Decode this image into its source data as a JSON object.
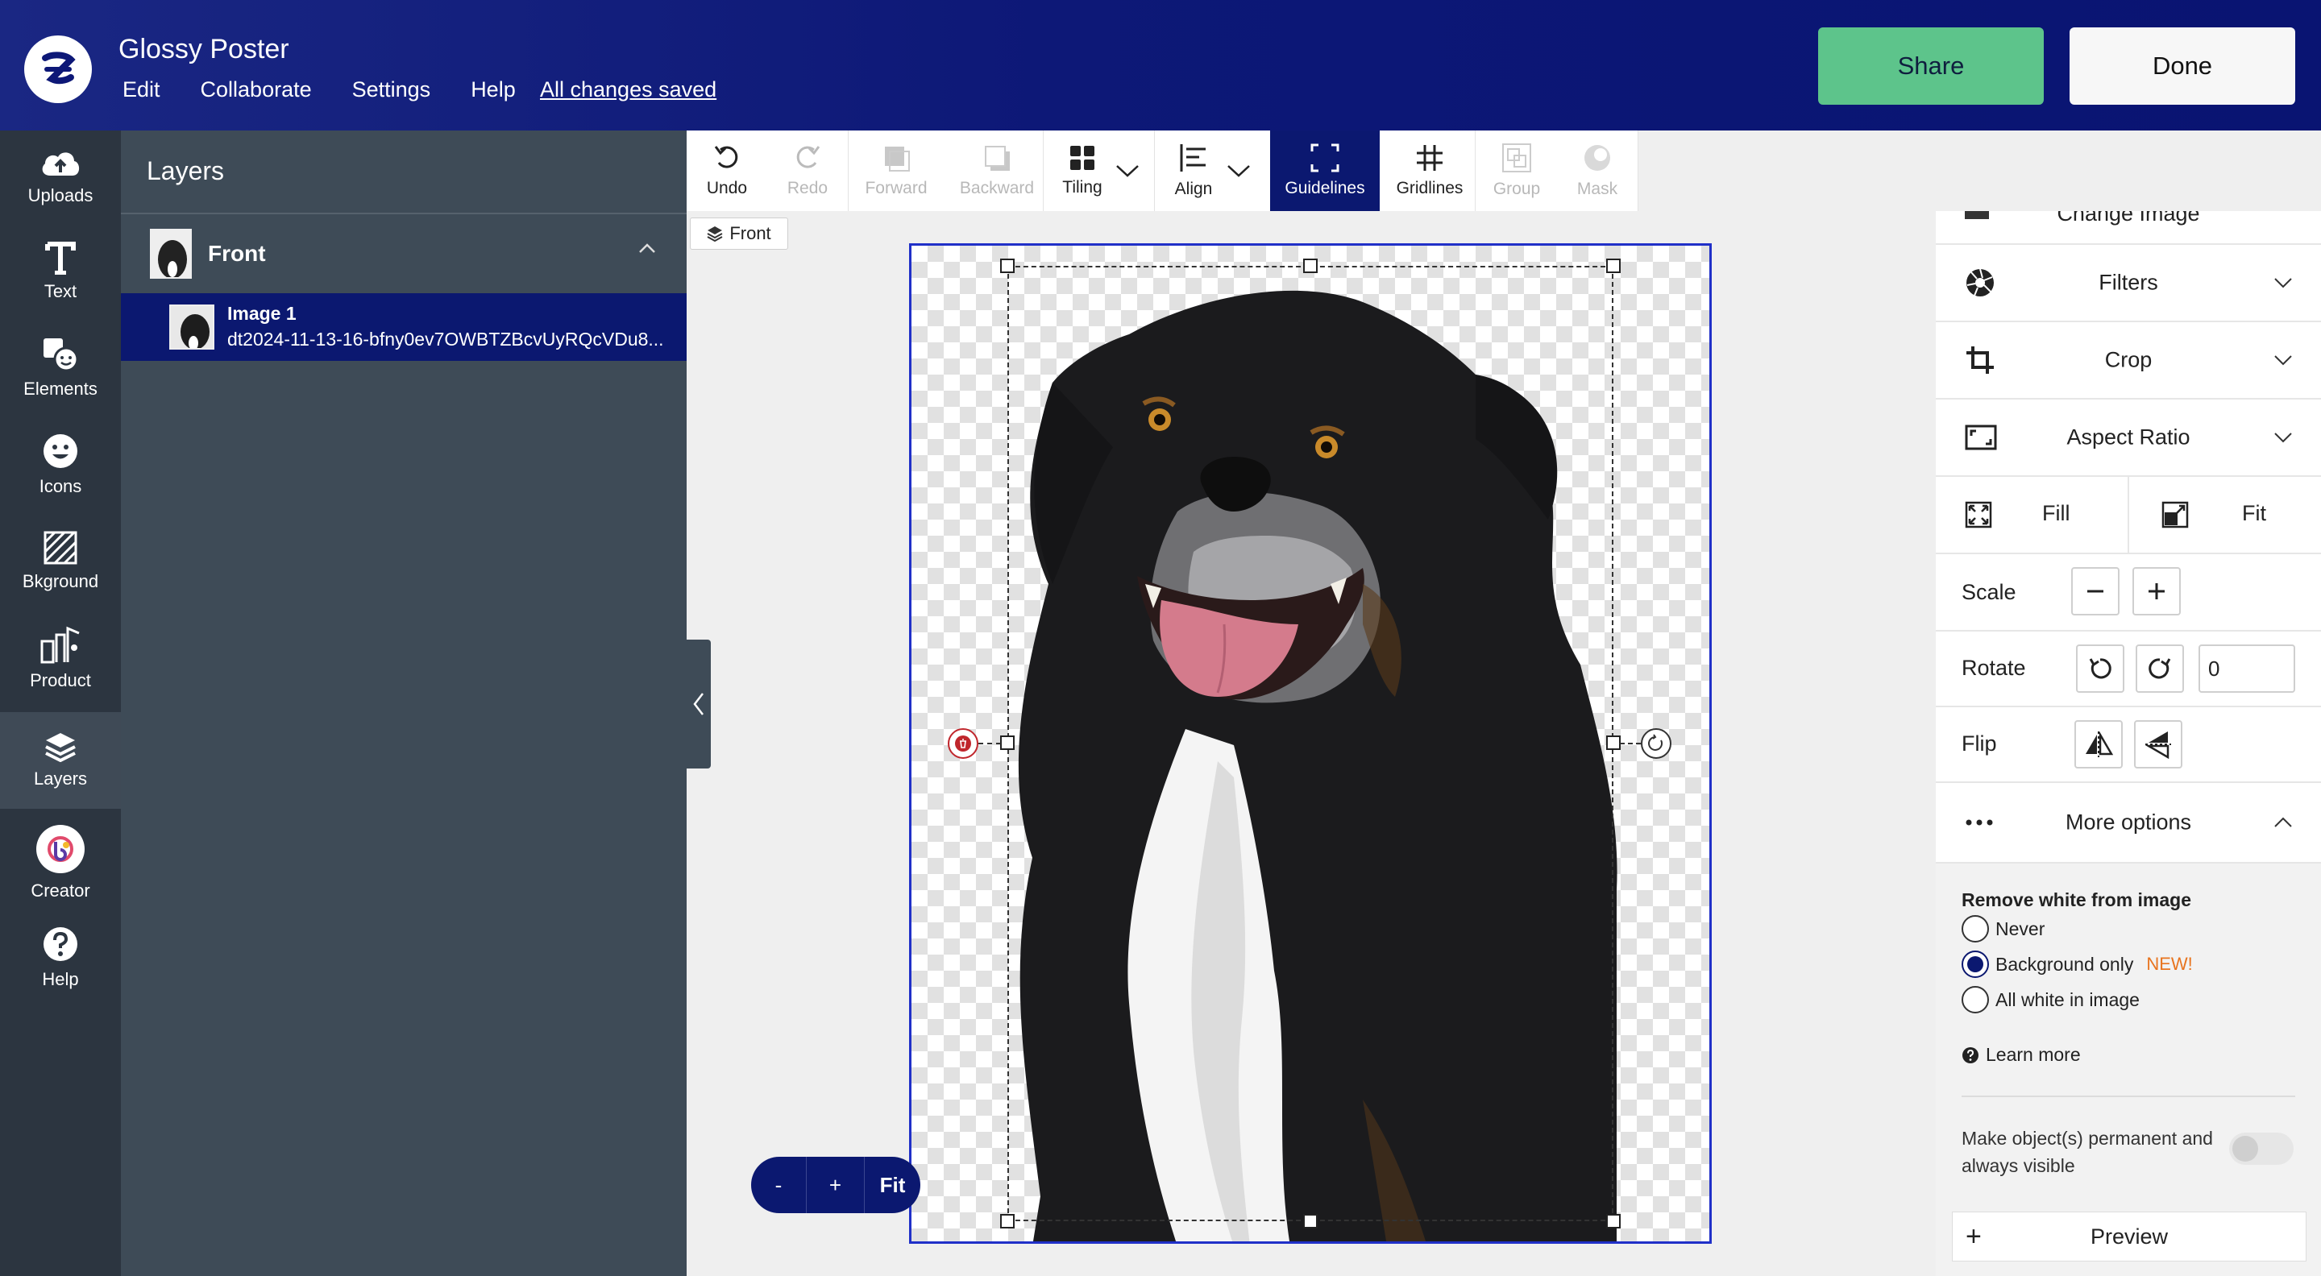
{
  "header": {
    "title": "Glossy Poster",
    "menu": [
      "Edit",
      "Collaborate",
      "Settings",
      "Help"
    ],
    "save_status": "All changes saved",
    "share_label": "Share",
    "done_label": "Done"
  },
  "rail": {
    "items": [
      "Uploads",
      "Text",
      "Elements",
      "Icons",
      "Bkground",
      "Product",
      "Layers",
      "Creator",
      "Help"
    ],
    "active": "Layers"
  },
  "layers": {
    "title": "Layers",
    "group_name": "Front",
    "item_name": "Image 1",
    "item_file": "dt2024-11-13-16-bfny0ev7OWBTZBcvUyRQcVDu8..."
  },
  "toolbar": {
    "undo": "Undo",
    "redo": "Redo",
    "forward": "Forward",
    "backward": "Backward",
    "tiling": "Tiling",
    "align": "Align",
    "guidelines": "Guidelines",
    "gridlines": "Gridlines",
    "group": "Group",
    "mask": "Mask"
  },
  "canvas": {
    "side_tag": "Front",
    "zoom_minus": "-",
    "zoom_plus": "+",
    "zoom_fit": "Fit"
  },
  "props": {
    "change_image": "Change Image",
    "filters": "Filters",
    "crop": "Crop",
    "aspect_ratio": "Aspect Ratio",
    "fill": "Fill",
    "fit": "Fit",
    "scale": "Scale",
    "rotate": "Rotate",
    "rotate_value": "0",
    "flip": "Flip",
    "more_options": "More options",
    "remove_white_title": "Remove white from image",
    "remove_white_options": [
      "Never",
      "Background only",
      "All white in image"
    ],
    "remove_white_selected": "Background only",
    "new_badge": "NEW!",
    "learn_more": "Learn more",
    "permanent_text": "Make object(s) permanent and always visible",
    "permanent_on": false,
    "preview": "Preview"
  },
  "colors": {
    "header_bg": "#0d1877",
    "accent_navy": "#0b1870",
    "share_green": "#5dc48b",
    "canvas_border": "#2030c8",
    "new_orange": "#e8741e"
  }
}
